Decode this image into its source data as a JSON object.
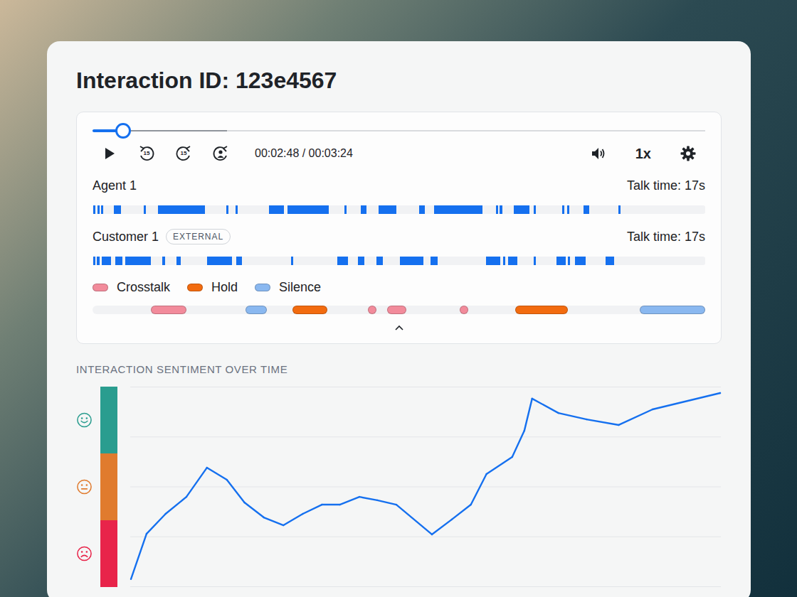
{
  "title": "Interaction ID: 123e4567",
  "player": {
    "level": 0.05,
    "buffered": 0.22,
    "playing": false,
    "skip_back": "15",
    "skip_forward": "15",
    "time": "00:02:48 / 00:03:24",
    "speed": "1x"
  },
  "speakers": [
    {
      "name": "Agent 1",
      "badges": [],
      "talk_time": "Talk time: 17s",
      "segments": [
        [
          0.001,
          0.004
        ],
        [
          0.008,
          0.011
        ],
        [
          0.014,
          0.017
        ],
        [
          0.035,
          0.047
        ],
        [
          0.084,
          0.087
        ],
        [
          0.107,
          0.184
        ],
        [
          0.218,
          0.221
        ],
        [
          0.234,
          0.237
        ],
        [
          0.288,
          0.312
        ],
        [
          0.318,
          0.386
        ],
        [
          0.411,
          0.413
        ],
        [
          0.438,
          0.447
        ],
        [
          0.467,
          0.496
        ],
        [
          0.533,
          0.542
        ],
        [
          0.557,
          0.637
        ],
        [
          0.658,
          0.66
        ],
        [
          0.664,
          0.669
        ],
        [
          0.688,
          0.713
        ],
        [
          0.72,
          0.723
        ],
        [
          0.766,
          0.769
        ],
        [
          0.775,
          0.778
        ],
        [
          0.801,
          0.811
        ],
        [
          0.858,
          0.861
        ]
      ]
    },
    {
      "name": "Customer 1",
      "badges": [
        "EXTERNAL"
      ],
      "talk_time": "Talk time: 17s",
      "segments": [
        [
          0.001,
          0.005
        ],
        [
          0.007,
          0.012
        ],
        [
          0.015,
          0.03
        ],
        [
          0.037,
          0.049
        ],
        [
          0.053,
          0.095
        ],
        [
          0.114,
          0.119
        ],
        [
          0.137,
          0.144
        ],
        [
          0.187,
          0.228
        ],
        [
          0.235,
          0.244
        ],
        [
          0.324,
          0.326
        ],
        [
          0.399,
          0.417
        ],
        [
          0.433,
          0.444
        ],
        [
          0.463,
          0.474
        ],
        [
          0.502,
          0.54
        ],
        [
          0.552,
          0.563
        ],
        [
          0.642,
          0.665
        ],
        [
          0.67,
          0.674
        ],
        [
          0.678,
          0.693
        ],
        [
          0.72,
          0.724
        ],
        [
          0.757,
          0.772
        ],
        [
          0.776,
          0.778
        ],
        [
          0.788,
          0.805
        ],
        [
          0.837,
          0.851
        ]
      ]
    }
  ],
  "legend": [
    {
      "kind": "crosstalk",
      "label": "Crosstalk",
      "color": "#f28b9b"
    },
    {
      "kind": "hold",
      "label": "Hold",
      "color": "#f26b0f"
    },
    {
      "kind": "silence",
      "label": "Silence",
      "color": "#8ab8f0"
    }
  ],
  "events": [
    {
      "kind": "crosstalk",
      "start": 0.095,
      "end": 0.153
    },
    {
      "kind": "silence",
      "start": 0.25,
      "end": 0.284
    },
    {
      "kind": "hold",
      "start": 0.326,
      "end": 0.383
    },
    {
      "kind": "crosstalk",
      "start": 0.45,
      "end": 0.463
    },
    {
      "kind": "crosstalk",
      "start": 0.481,
      "end": 0.512
    },
    {
      "kind": "crosstalk",
      "start": 0.599,
      "end": 0.613
    },
    {
      "kind": "hold",
      "start": 0.69,
      "end": 0.776
    },
    {
      "kind": "silence",
      "start": 0.893,
      "end": 1.0
    }
  ],
  "expanded": true,
  "sentiment": {
    "title": "INTERACTION SENTIMENT OVER TIME",
    "bands": [
      {
        "kind": "positive",
        "color": "#2a9d8f"
      },
      {
        "kind": "neutral",
        "color": "#e07b2e"
      },
      {
        "kind": "negative",
        "color": "#e8244a"
      }
    ],
    "points": [
      [
        0,
        3.6
      ],
      [
        5.4,
        26.3
      ],
      [
        12.0,
        36.3
      ],
      [
        19.2,
        44.8
      ],
      [
        26.3,
        59.4
      ],
      [
        33.2,
        53.4
      ],
      [
        39.3,
        42.0
      ],
      [
        46.0,
        34.5
      ],
      [
        52.8,
        30.6
      ],
      [
        59.5,
        36.3
      ],
      [
        66.1,
        40.9
      ],
      [
        72.3,
        40.9
      ],
      [
        79.1,
        44.8
      ],
      [
        85.3,
        43.1
      ],
      [
        91.9,
        40.9
      ],
      [
        104.2,
        26.0
      ],
      [
        111.1,
        33.5
      ],
      [
        117.7,
        40.9
      ],
      [
        123.1,
        56.2
      ],
      [
        132.0,
        64.8
      ],
      [
        136.2,
        77.9
      ],
      [
        138.9,
        94.0
      ],
      [
        148.0,
        86.8
      ],
      [
        157.8,
        83.6
      ],
      [
        168.9,
        80.8
      ],
      [
        180.6,
        88.6
      ],
      [
        204,
        96.8
      ]
    ]
  }
}
